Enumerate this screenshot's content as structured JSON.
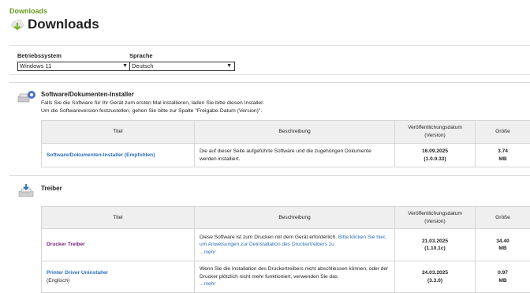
{
  "breadcrumb": "Downloads",
  "page_title": "Downloads",
  "filters": {
    "os_label": "Betriebssystem",
    "os_value": "Windows 11",
    "lang_label": "Sprache",
    "lang_value": "Deutsch"
  },
  "sections": {
    "installer": {
      "title": "Software/Dokumenten-Installer",
      "desc1": "Falls Sie die Software für Ihr Gerät zum ersten Mal installieren, laden Sie bitte diesen Installer.",
      "desc2": "Um die Softwareversion festzustellen, gehen Sie bitte zur Spalte \"Freigabe-Datum (Version)\".",
      "headers": {
        "title": "Titel",
        "desc": "Beschreibung",
        "date": "Veröffentlichungsdatum",
        "version": "(Version)",
        "size": "Größe"
      },
      "rows": [
        {
          "title": "Software/Dokumenten-Installer (Empfohlen)",
          "desc": "Die auf dieser Seite aufgeführte Software und die zugehörigen Dokumente werden installiert.",
          "date": "16.09.2025",
          "version": "(1.0.0.33)",
          "size1": "3.74",
          "size2": "MB"
        }
      ]
    },
    "drivers": {
      "title": "Treiber",
      "headers": {
        "title": "Titel",
        "desc": "Beschreibung",
        "date": "Veröffentlichungsdatum",
        "version": "(Version)",
        "size": "Größe"
      },
      "rows": [
        {
          "title": "Drucker Treiber",
          "desc_text": "Diese Software ist zum Drucken mit dem Gerät erforderlich. ",
          "desc_link": "Bitte klicken Sie hier, um Anweisungen zur Deinstallation des Druckertreibers zu",
          "more": "...mehr",
          "date": "21.03.2025",
          "version": "(1.10.1c)",
          "size1": "34.40",
          "size2": "MB"
        },
        {
          "title": "Printer Driver Uninstaller",
          "subtitle": "(Englisch)",
          "desc_text": "Wenn Sie die Installation des Druckertreibers nicht abschliessen können, oder der Drucker plötzlich nicht mehr funktioniert, verwenden Sie das",
          "more": "...mehr",
          "date": "24.03.2025",
          "version": "(3.3.0)",
          "size1": "0.97",
          "size2": "MB"
        }
      ]
    }
  },
  "icons": {
    "title": "download-cloud-icon",
    "installer": "installer-package-icon",
    "drivers": "printer-driver-icon",
    "select": "chevron-down-icon"
  },
  "colors": {
    "breadcrumb": "#6b9a1f",
    "link": "#2a6ebb",
    "visited_link": "#7a1d7a"
  }
}
